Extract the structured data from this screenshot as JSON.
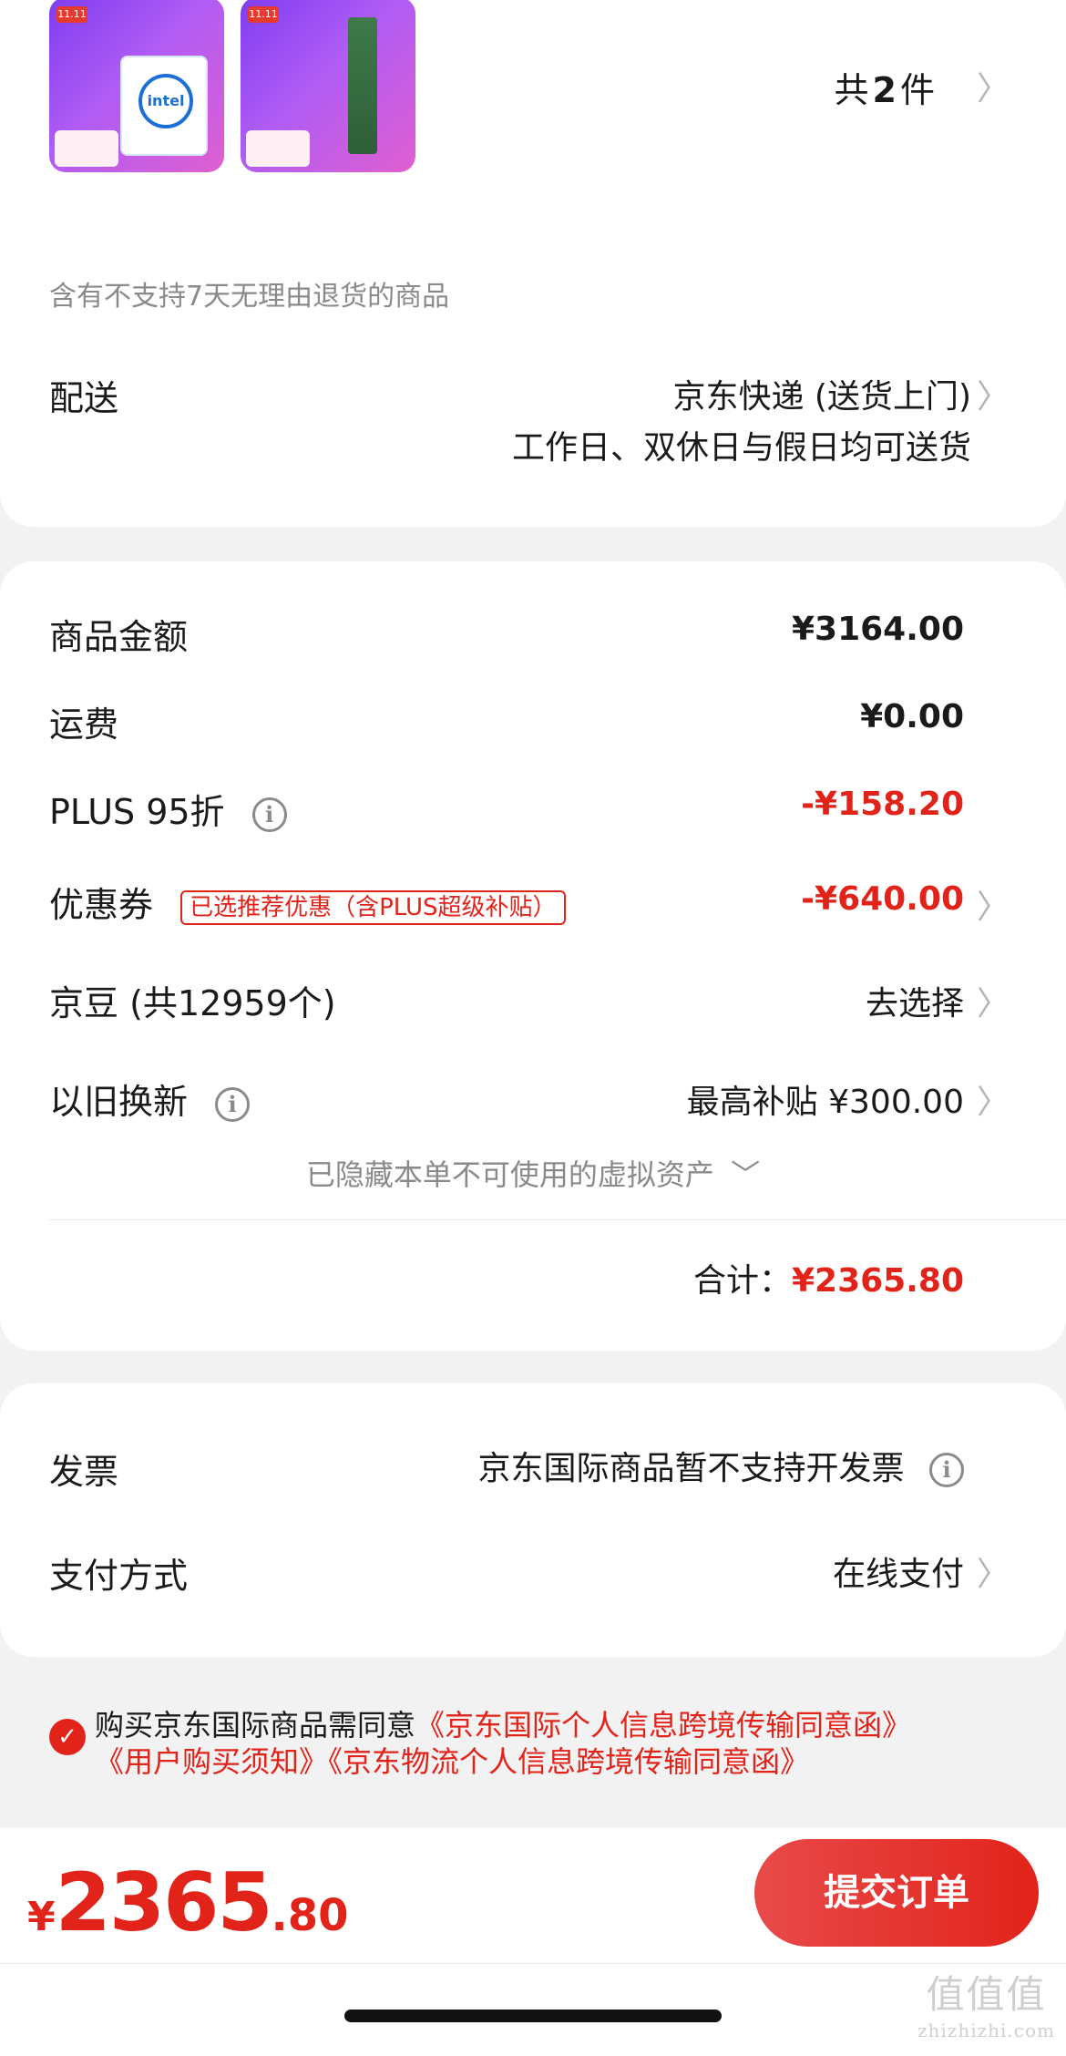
{
  "goods": {
    "count_prefix": "共",
    "count_value": "2",
    "count_suffix": "件",
    "thumb1_badge": "11.11",
    "thumb1_logo": "intel",
    "thumb2_badge": "11.11",
    "return_notice": "含有不支持7天无理由退货的商品"
  },
  "delivery": {
    "label": "配送",
    "method": "京东快递 (送货上门)",
    "schedule": "工作日、双休日与假日均可送货"
  },
  "price": {
    "goods_amount_label": "商品金额",
    "goods_amount_value": "¥3164.00",
    "shipping_label": "运费",
    "shipping_value": "¥0.00",
    "plus_label": "PLUS 95折",
    "plus_value": "-¥158.20",
    "coupon_label": "优惠券",
    "coupon_tag": "已选推荐优惠（含PLUS超级补贴）",
    "coupon_value": "-¥640.00",
    "jingdou_label": "京豆 (共12959个)",
    "jingdou_value": "去选择",
    "tradein_label": "以旧换新",
    "tradein_value": "最高补贴 ¥300.00",
    "hidden_assets": "已隐藏本单不可使用的虚拟资产",
    "total_label": "合计：",
    "total_value": "¥2365.80"
  },
  "invoice": {
    "label": "发票",
    "value": "京东国际商品暂不支持开发票",
    "payment_label": "支付方式",
    "payment_value": "在线支付"
  },
  "agreement": {
    "prefix": "购买京东国际商品需同意",
    "link1": "《京东国际个人信息跨境传输同意函》",
    "link2": "《用户购买须知》",
    "link3": "《京东物流个人信息跨境传输同意函》"
  },
  "footer": {
    "currency": "¥",
    "amount_int": "2365",
    "amount_dec": ".80",
    "submit_label": "提交订单"
  },
  "watermark": {
    "text": "值值值",
    "sub": "zhizhizhi.com"
  },
  "colors": {
    "accent": "#e2231a",
    "background": "#f2f2f2"
  }
}
